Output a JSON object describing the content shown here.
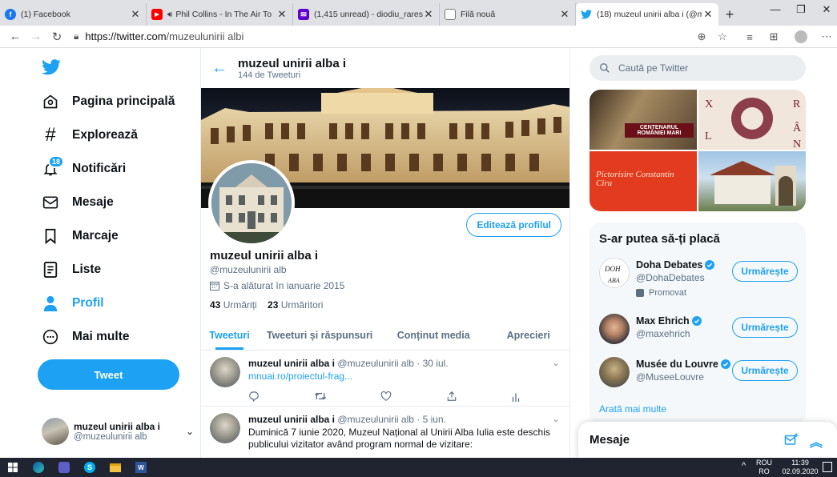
{
  "browser": {
    "tabs": [
      {
        "title": "(1) Facebook",
        "color": "#1877f2",
        "glyph": "f"
      },
      {
        "title": "Phil Collins - In The Air To",
        "color": "#ff0000",
        "glyph": "▶"
      },
      {
        "title": "(1,415 unread) - diodiu_rares@",
        "color": "#6001d2",
        "glyph": "✉"
      },
      {
        "title": "Filă nouă",
        "color": "#888888",
        "glyph": "▭"
      },
      {
        "title": "(18) muzeul unirii alba i (@mu",
        "color": "#1da1f2",
        "glyph": "🐦"
      }
    ],
    "url_host": "https://twitter.com",
    "url_path": "/muzeulunirii albi"
  },
  "sidebar": {
    "items": [
      {
        "label": "Pagina principală"
      },
      {
        "label": "Explorează"
      },
      {
        "label": "Notificări",
        "badge": "18"
      },
      {
        "label": "Mesaje"
      },
      {
        "label": "Marcaje"
      },
      {
        "label": "Liste"
      },
      {
        "label": "Profil"
      },
      {
        "label": "Mai multe"
      }
    ],
    "tweet_button": "Tweet",
    "account_name": "muzeul unirii alba i",
    "account_handle": "@muzeulunirii alb"
  },
  "profile": {
    "header_name": "muzeul unirii alba i",
    "tweet_count": "144 de Tweeturi",
    "edit_button": "Editează profilul",
    "name": "muzeul unirii alba i",
    "handle": "@muzeulunirii alb",
    "joined": "S-a alăturat în ianuarie 2015",
    "following_count": "43",
    "following_label": "Urmăriți",
    "followers_count": "23",
    "followers_label": "Urmăritori",
    "tabs": [
      "Tweeturi",
      "Tweeturi și răspunsuri",
      "Conținut media",
      "Aprecieri"
    ]
  },
  "tweets": [
    {
      "name": "muzeul unirii alba i",
      "handle": "@muzeulunirii alb",
      "date": "· 30 iul.",
      "text": "mnuai.ro/proiectul-frag..."
    },
    {
      "name": "muzeul unirii alba i",
      "handle": "@muzeulunirii alb",
      "date": "· 5 iun.",
      "text": "Duminică 7 iunie 2020, Muzeul Național al Unirii Alba Iulia este deschis publicului vizitator având program normal de vizitare:"
    }
  ],
  "right": {
    "search_placeholder": "Caută pe Twitter",
    "suggest_title": "S-ar putea să-ți placă",
    "suggestions": [
      {
        "name": "Doha Debates",
        "handle": "@DohaDebates",
        "promoted": "Promovat",
        "button": "Urmărește"
      },
      {
        "name": "Max Ehrich",
        "handle": "@maxehrich",
        "button": "Urmărește"
      },
      {
        "name": "Musée du Louvre",
        "handle": "@MuseeLouvre",
        "button": "Urmărește"
      }
    ],
    "show_more": "Arată mai multe",
    "messages": "Mesaje",
    "media": {
      "img2_text": "CENTENARUL ROMÂNIEI MARI",
      "img3_text": "Pictorisire Constantin Ciru"
    }
  },
  "taskbar": {
    "lang1": "ROU",
    "lang2": "RO",
    "time": "11:39",
    "date": "02.09.2020"
  }
}
